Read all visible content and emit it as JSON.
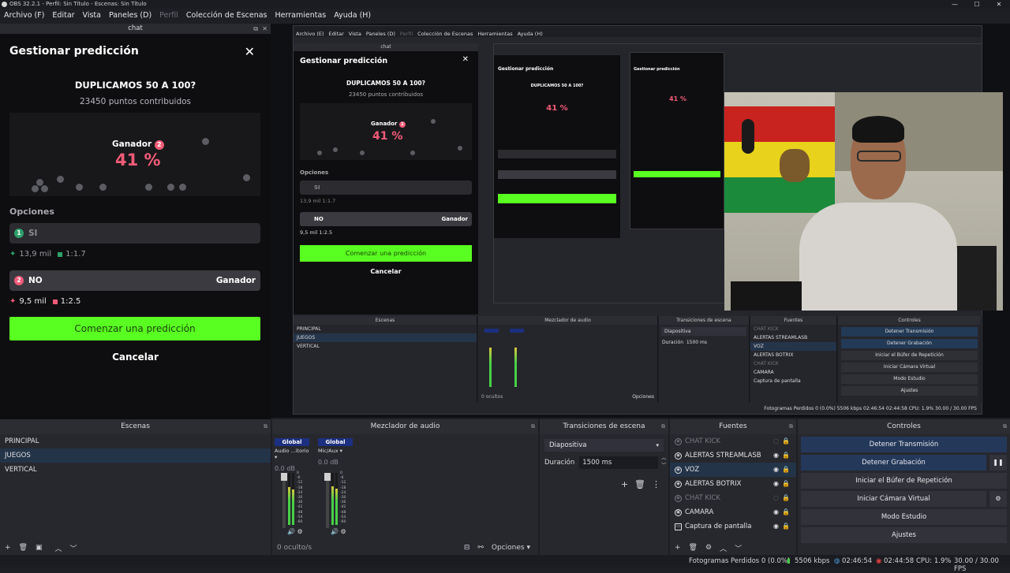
{
  "window": {
    "title": "OBS 32.2.1 - Perfil: Sin Título - Escenas: Sin Título"
  },
  "menu": [
    "Archivo (F)",
    "Editar",
    "Vista",
    "Paneles (D)",
    "Perfil",
    "Colección de Escenas",
    "Herramientas",
    "Ayuda (H)"
  ],
  "chat_dock": {
    "title": "chat",
    "prediction": {
      "header": "Gestionar predicción",
      "close": "✕",
      "question": "DUPLICAMOS 50 A 100?",
      "points": "23450 puntos contribuidos",
      "winner_label": "Ganador",
      "winner_num": "2",
      "percent": "41 %",
      "options_label": "Opciones",
      "option1": {
        "num": "1",
        "label": "SI",
        "points": "13,9 mil",
        "ratio": "1:1.7"
      },
      "option2": {
        "num": "2",
        "label": "NO",
        "winner": "Ganador",
        "points": "9,5 mil",
        "ratio": "1:2.5"
      },
      "start_button": "Comenzar una predicción",
      "cancel_button": "Cancelar"
    }
  },
  "preview_nested": {
    "menu": [
      "Archivo (E)",
      "Editar",
      "Vista",
      "Paneles (D)",
      "Perfil",
      "Colección de Escenas",
      "Herramientas",
      "Ayuda (H)"
    ],
    "chat_title": "chat",
    "header": "Gestionar predicción",
    "question": "DUPLICAMOS 50 A 100?",
    "points": "23450 puntos contribuidos",
    "winner": "Ganador",
    "percent": "41 %",
    "options": "Opciones",
    "opt1": "SI",
    "opt1_stats": "13,9 mil   1:1.7",
    "opt2": "NO",
    "opt2_winner": "Ganador",
    "opt2_stats": "9,5 mil   1:2.5",
    "start": "Comenzar una predicción",
    "cancel": "Cancelar",
    "scenes_title": "Escenas",
    "scenes": [
      "PRINCIPAL",
      "JUEGOS",
      "VERTICAL"
    ],
    "mixer_title": "Mezclador de audio",
    "transitions_title": "Transiciones de escena",
    "transition": "Diapositiva",
    "duration_label": "Duración",
    "duration": "1500 ms",
    "sources_title": "Fuentes",
    "sources": [
      "CHAT KICK",
      "ALERTAS STREAMLASB",
      "VOZ",
      "ALERTAS BOTRIX",
      "CHAT KICK",
      "CAMARA",
      "Captura de pantalla"
    ],
    "controls_title": "Controles",
    "controls": [
      "Detener Transmisión",
      "Detener Grabación",
      "Iniciar el Búfer de Repetición",
      "Iniciar Cámara Virtual",
      "Modo Estudio",
      "Ajustes"
    ],
    "hidden": "0 ocultos",
    "options_menu": "Opciones",
    "status": "Fotogramas Perdidos 0 (0.0%)   5506 kbps   02:46:54   02:44:58   CPU: 1.9%   30.00 / 30.00 FPS"
  },
  "scenes": {
    "title": "Escenas",
    "items": [
      "PRINCIPAL",
      "JUEGOS",
      "VERTICAL"
    ],
    "selected": "JUEGOS"
  },
  "mixer": {
    "title": "Mezclador de audio",
    "channels": [
      {
        "header": "Global",
        "name": "Audio ...itorio",
        "db": "0.0 dB"
      },
      {
        "header": "Global",
        "name": "Mic/Aux",
        "db": "0.0 dB"
      }
    ],
    "ticks": [
      "0",
      "-6",
      "-12",
      "-18",
      "-24",
      "-30",
      "-36",
      "-42",
      "-48",
      "-54",
      "-60"
    ],
    "hidden": "0 oculto/s",
    "options": "Opciones"
  },
  "transitions": {
    "title": "Transiciones de escena",
    "selected": "Diapositiva",
    "duration_label": "Duración",
    "duration": "1500 ms"
  },
  "sources": {
    "title": "Fuentes",
    "items": [
      {
        "label": "CHAT KICK",
        "dim": true
      },
      {
        "label": "ALERTAS STREAMLASB",
        "dim": false
      },
      {
        "label": "VOZ",
        "dim": false
      },
      {
        "label": "ALERTAS BOTRIX",
        "dim": false
      },
      {
        "label": "CHAT KICK",
        "dim": true
      },
      {
        "label": "CAMARA",
        "dim": false
      },
      {
        "label": "Captura de pantalla",
        "dim": false
      }
    ]
  },
  "controls": {
    "title": "Controles",
    "stop_stream": "Detener Transmisión",
    "stop_record": "Detener Grabación",
    "replay": "Iniciar el Búfer de Repetición",
    "virtual_cam": "Iniciar Cámara Virtual",
    "studio": "Modo Estudio",
    "settings": "Ajustes"
  },
  "status": {
    "dropped": "Fotogramas Perdidos 0 (0.0%)",
    "bitrate": "5506 kbps",
    "stream_time": "02:46:54",
    "rec_time": "02:44:58",
    "cpu": "CPU: 1.9%",
    "fps": "30.00 / 30.00 FPS"
  },
  "colors": {
    "accent_green": "#59ff20",
    "pink": "#f25b77",
    "teal": "#2ea06a",
    "selection": "#233448"
  }
}
